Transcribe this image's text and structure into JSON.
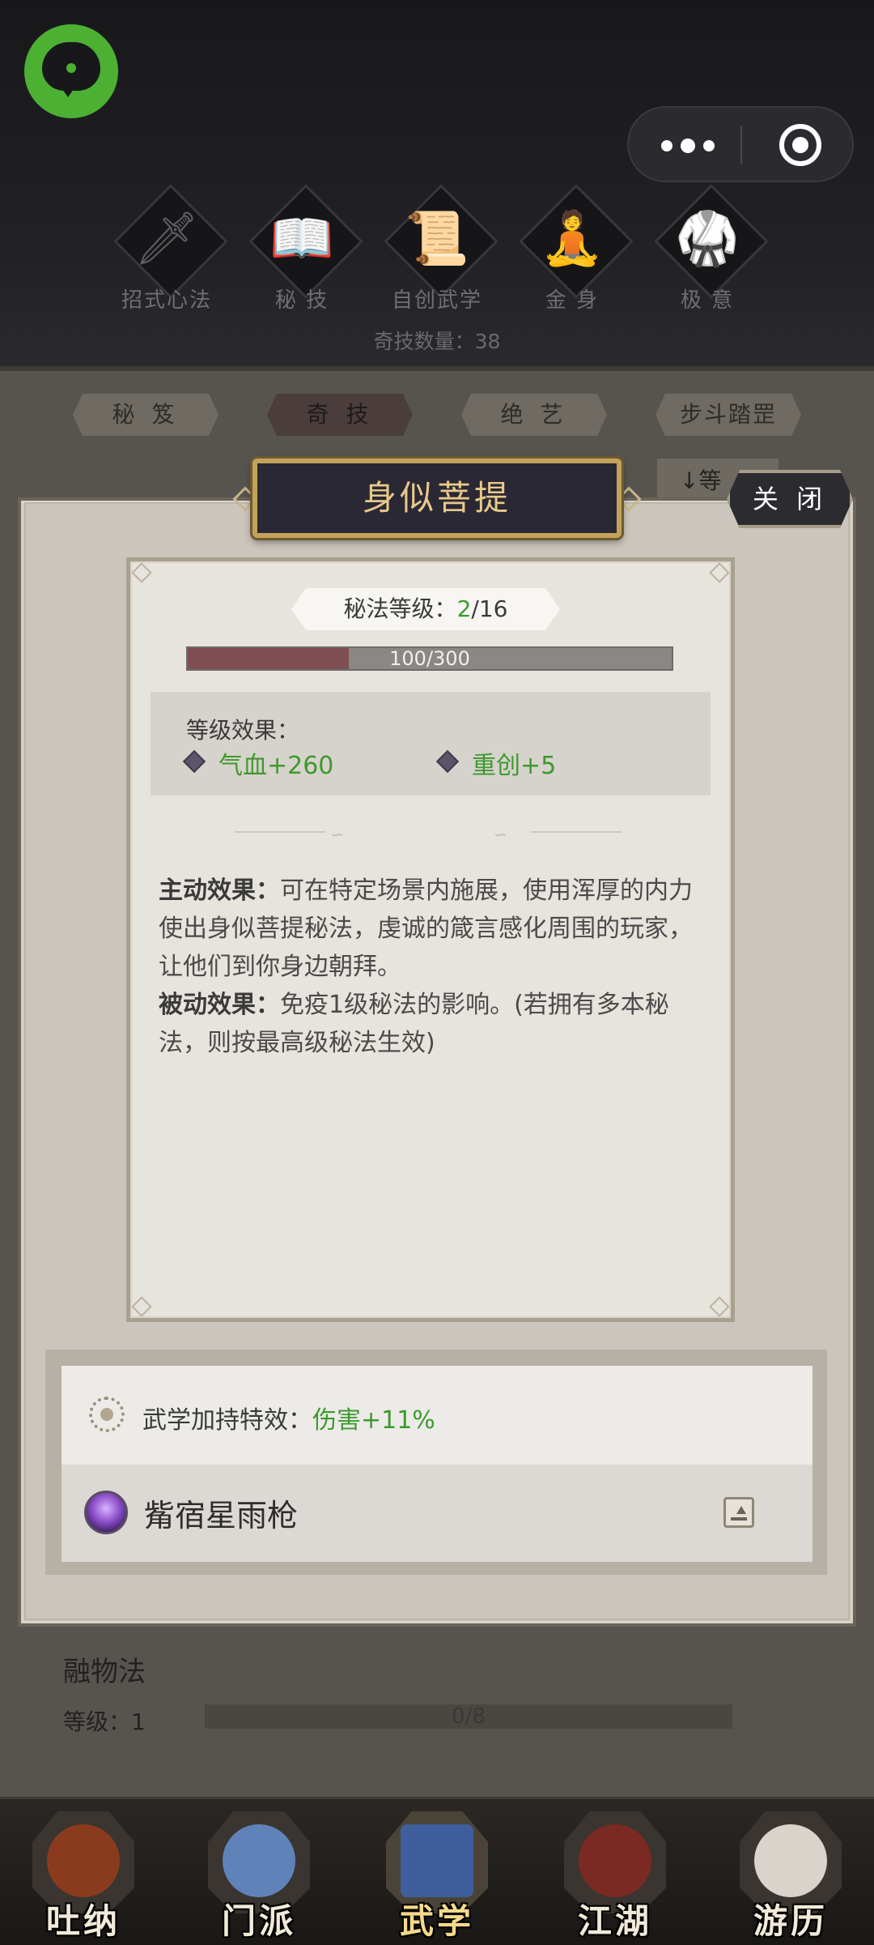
{
  "skill_tabs": [
    {
      "label": "招式心法",
      "icon": "sword-icon",
      "glyph": "🗡"
    },
    {
      "label": "秘 技",
      "icon": "book-icon",
      "glyph": "📖"
    },
    {
      "label": "自创武学",
      "icon": "scroll-icon",
      "glyph": "📜"
    },
    {
      "label": "金 身",
      "icon": "meditation-icon",
      "glyph": "🧘"
    },
    {
      "label": "极 意",
      "icon": "fighter-icon",
      "glyph": "🥋"
    }
  ],
  "count_label": "奇技数量：38",
  "categories": [
    "秘 笈",
    "奇 技",
    "绝 艺",
    "步斗踏罡"
  ],
  "active_category": 1,
  "sort_label": "↓等",
  "modal": {
    "title": "身似菩提",
    "close_label": "关 闭",
    "level_label": "秘法等级：",
    "level_current": "2",
    "level_max": "/16",
    "xp_text": "100/300",
    "xp_fraction": 0.333,
    "effects_title": "等级效果：",
    "effects": [
      "气血+260",
      "重创+5"
    ],
    "active_label": "主动效果：",
    "active_text": "可在特定场景内施展，使用浑厚的内力使出身似菩提秘法，虔诚的箴言感化周围的玩家，让他们到你身边朝拜。",
    "passive_label": "被动效果：",
    "passive_text": "免疫1级秘法的影响。(若拥有多本秘法，则按最高级秘法生效)",
    "bonus_label": "武学加持特效：",
    "bonus_value": "伤害+11%",
    "weapon_name": "觜宿星雨枪"
  },
  "background_item": {
    "title": "融物法",
    "level_label": "等级：1",
    "progress_text": "0/8"
  },
  "bottom_nav": [
    {
      "label": "吐纳",
      "icon": "meditating-figure-icon",
      "color": "#8a3b1e"
    },
    {
      "label": "门派",
      "icon": "banner-icon",
      "color": "#5f83b8"
    },
    {
      "label": "武学",
      "icon": "books-icon",
      "color": "#3f5f9c"
    },
    {
      "label": "江湖",
      "icon": "hat-icon",
      "color": "#7a2a22"
    },
    {
      "label": "游历",
      "icon": "horse-icon",
      "color": "#d8d4cc"
    }
  ],
  "active_nav": 2
}
